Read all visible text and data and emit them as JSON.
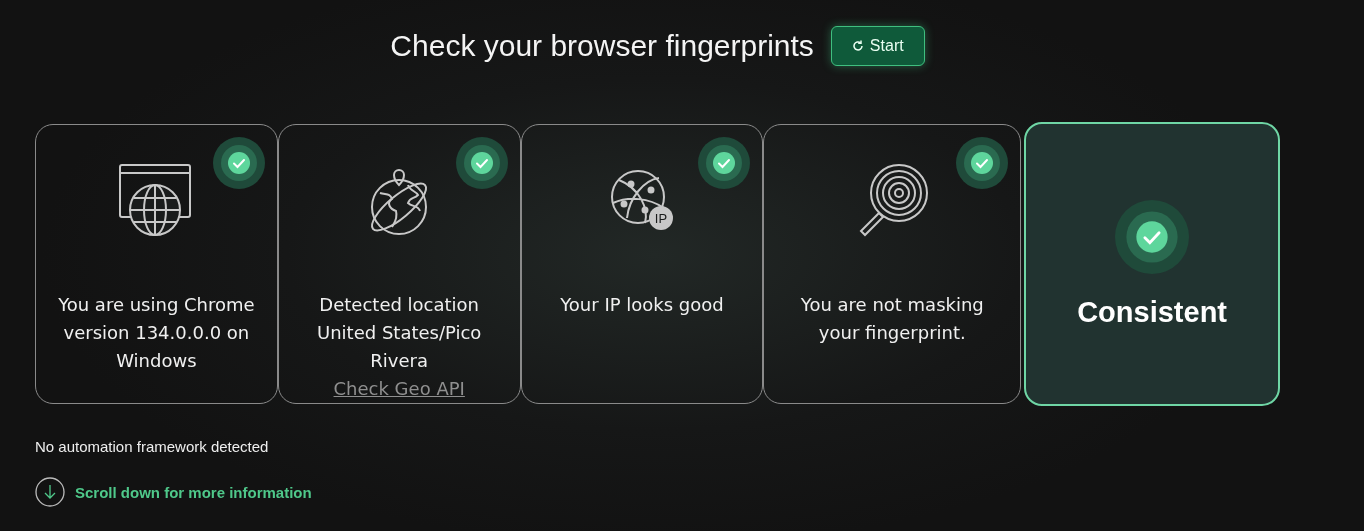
{
  "header": {
    "title": "Check your browser fingerprints",
    "start_button": "Start"
  },
  "checks": [
    {
      "kind": "browser",
      "text": "You are using Chrome version 134.0.0.0 on Windows",
      "passed": true
    },
    {
      "kind": "location",
      "text": "Detected location United States/Pico Rivera",
      "link": "Check Geo API",
      "passed": true
    },
    {
      "kind": "ip",
      "text": "Your IP looks good",
      "icon_label": "IP",
      "passed": true
    },
    {
      "kind": "fingerprint",
      "text": "You are not masking your fingerprint.",
      "passed": true
    }
  ],
  "summary": {
    "status": "Consistent",
    "passed": true
  },
  "automation_note": "No automation framework detected",
  "scroll_hint": "Scroll down for more information"
}
